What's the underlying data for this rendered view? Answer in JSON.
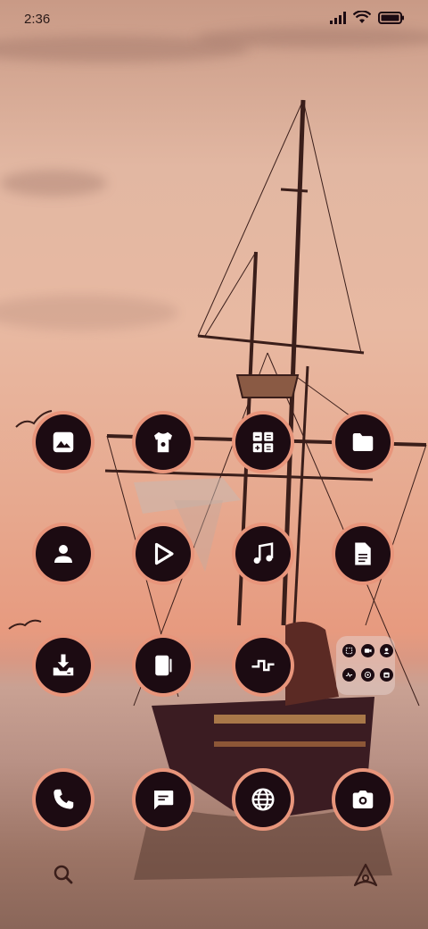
{
  "status_bar": {
    "time": "2:36"
  },
  "home": {
    "apps": [
      {
        "icon": "gallery-icon"
      },
      {
        "icon": "theme-icon"
      },
      {
        "icon": "calculator-icon"
      },
      {
        "icon": "folder-icon"
      },
      {
        "icon": "contacts-icon"
      },
      {
        "icon": "video-player-icon"
      },
      {
        "icon": "music-icon"
      },
      {
        "icon": "notes-icon"
      },
      {
        "icon": "downloads-icon"
      },
      {
        "icon": "tablet-icon"
      },
      {
        "icon": "health-icon"
      },
      {
        "icon": "phone-icon"
      },
      {
        "icon": "messages-icon"
      },
      {
        "icon": "browser-icon"
      },
      {
        "icon": "camera-icon"
      }
    ],
    "folder_widget": {
      "icons": [
        "screenshot-icon",
        "video-icon",
        "user-icon",
        "settings-icon",
        "whatsapp-icon",
        "calendar-icon"
      ]
    }
  },
  "dock": {
    "search_icon": "search-icon",
    "assistant_icon": "assistant-icon"
  },
  "colors": {
    "icon_ring": "#e8957b",
    "icon_bg": "#1c0b12",
    "icon_glyph": "#ffffff"
  }
}
